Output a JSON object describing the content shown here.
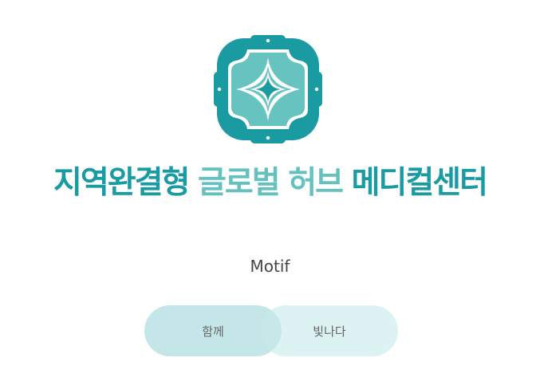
{
  "headline": {
    "part1": "지역완결형",
    "part2": "글로벌",
    "part3": "허브",
    "part4": "메디컬센터"
  },
  "caption": "Motif",
  "pills": {
    "left": "함께",
    "right": "빛나다"
  },
  "colors": {
    "teal_dark": "#1a9ba1",
    "teal_light": "#64c1bd",
    "pill_left": "#9fd5d9",
    "pill_right": "#c6eaea"
  },
  "icons": {
    "emblem": "medical-center-emblem-icon"
  }
}
